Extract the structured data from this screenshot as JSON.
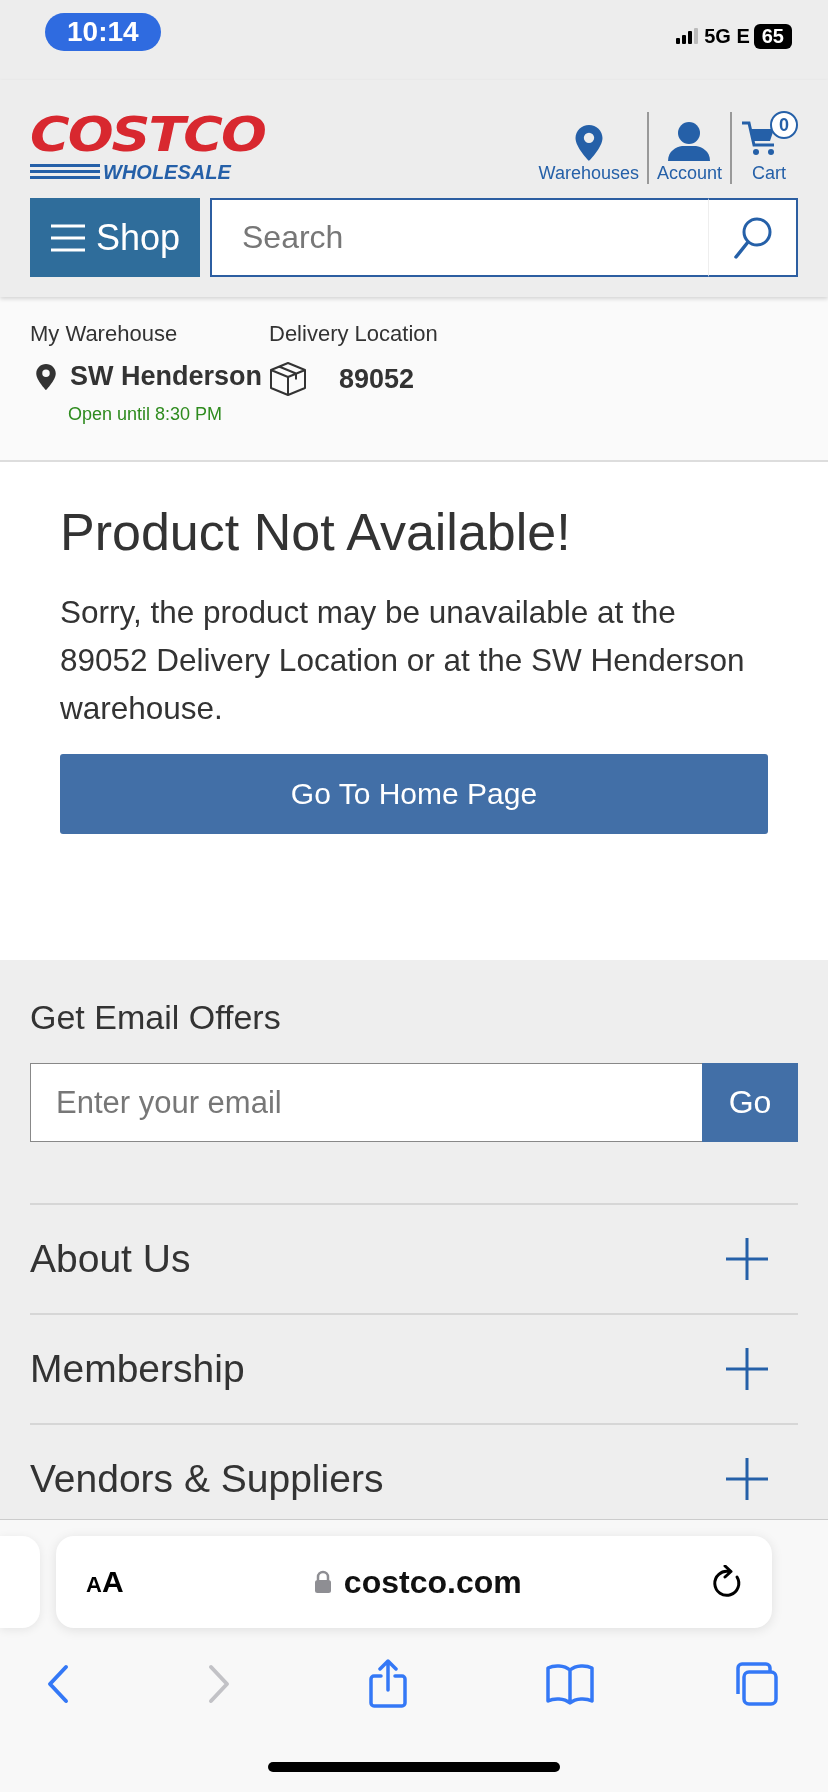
{
  "status_bar": {
    "time": "10:14",
    "network": "5G E",
    "battery": "65"
  },
  "header": {
    "logo": {
      "top": "COSTCO",
      "bottom": "WHOLESALE"
    },
    "nav": [
      {
        "kind": "pin",
        "label": "Warehouses"
      },
      {
        "kind": "person",
        "label": "Account"
      },
      {
        "kind": "cart",
        "label": "Cart",
        "badge": "0"
      }
    ],
    "shop_button": "Shop",
    "search": {
      "placeholder": "Search"
    }
  },
  "location": {
    "warehouse_label": "My Warehouse",
    "warehouse": "SW Henderson",
    "hours": "Open until 8:30 PM",
    "delivery_label": "Delivery Location",
    "delivery": "89052"
  },
  "message": {
    "title": "Product Not Available!",
    "body": "Sorry, the product may be unavailable at the 89052 Delivery Location or at the SW Henderson warehouse.",
    "button": "Go To Home Page"
  },
  "footer": {
    "email_title": "Get Email Offers",
    "email": {
      "placeholder": "Enter your email",
      "button": "Go"
    },
    "sections": [
      {
        "label": "About Us",
        "expanded": false
      },
      {
        "label": "Membership",
        "expanded": false
      },
      {
        "label": "Vendors & Suppliers",
        "expanded": false
      }
    ]
  },
  "browser": {
    "text_size": "AA",
    "url": "costco.com",
    "toolbar": [
      {
        "kind": "back",
        "disabled": false
      },
      {
        "kind": "forward",
        "disabled": true
      },
      {
        "kind": "share",
        "disabled": false
      },
      {
        "kind": "bookmarks",
        "disabled": false
      },
      {
        "kind": "tabs",
        "disabled": false
      }
    ]
  }
}
